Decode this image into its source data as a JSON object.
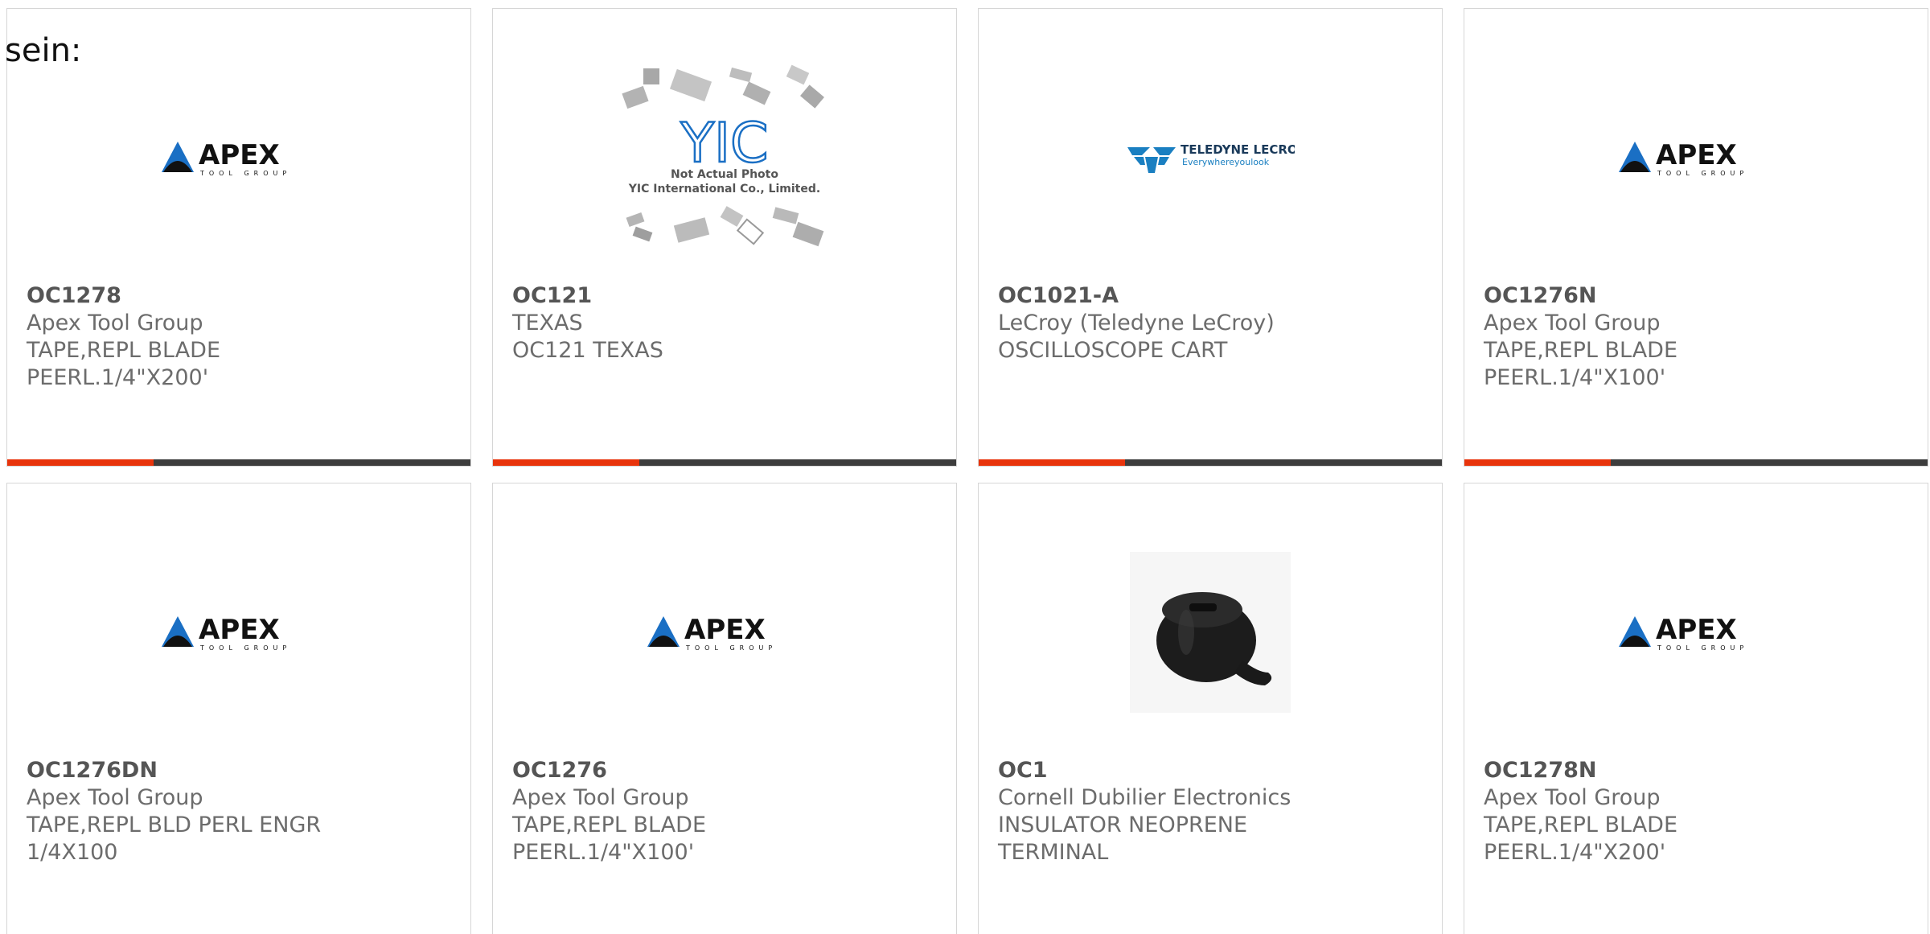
{
  "lead_text": "sein:",
  "colors": {
    "accent": "#e8340c",
    "bar": "#3d3d3d",
    "border": "#d6d6d6",
    "teledyne_blue": "#1a7fc1"
  },
  "cards": [
    {
      "pn": "OC1278",
      "mfr": "Apex Tool Group",
      "desc1": "TAPE,REPL BLADE",
      "desc2": "PEERL.1/4\"X200'",
      "image": "apex-logo",
      "logo_main": "APEX",
      "logo_sub": "TOOL GROUP"
    },
    {
      "pn": "OC121",
      "mfr": "TEXAS",
      "desc1": "OC121 TEXAS",
      "desc2": "",
      "image": "yic-placeholder",
      "logo_main": "YIC",
      "photo_note": "Not Actual Photo",
      "photo_company": "YIC International Co., Limited."
    },
    {
      "pn": "OC1021-A",
      "mfr": "LeCroy (Teledyne LeCroy)",
      "desc1": "OSCILLOSCOPE CART",
      "desc2": "",
      "image": "teledyne-logo",
      "logo_main": "TELEDYNE LECROY",
      "logo_sub": "Everywhereyoulook"
    },
    {
      "pn": "OC1276N",
      "mfr": "Apex Tool Group",
      "desc1": "TAPE,REPL BLADE",
      "desc2": "PEERL.1/4\"X100'",
      "image": "apex-logo",
      "logo_main": "APEX",
      "logo_sub": "TOOL GROUP"
    },
    {
      "pn": "OC1276DN",
      "mfr": "Apex Tool Group",
      "desc1": "TAPE,REPL BLD PERL ENGR",
      "desc2": "1/4X100",
      "image": "apex-logo",
      "logo_main": "APEX",
      "logo_sub": "TOOL GROUP"
    },
    {
      "pn": "OC1276",
      "mfr": "Apex Tool Group",
      "desc1": "TAPE,REPL BLADE",
      "desc2": "PEERL.1/4\"X100'",
      "image": "apex-logo",
      "logo_main": "APEX",
      "logo_sub": "TOOL GROUP"
    },
    {
      "pn": "OC1",
      "mfr": "Cornell Dubilier Electronics",
      "desc1": "INSULATOR NEOPRENE",
      "desc2": "TERMINAL",
      "image": "neoprene-insulator-photo"
    },
    {
      "pn": "OC1278N",
      "mfr": "Apex Tool Group",
      "desc1": "TAPE,REPL BLADE",
      "desc2": "PEERL.1/4\"X200'",
      "image": "apex-logo",
      "logo_main": "APEX",
      "logo_sub": "TOOL GROUP"
    }
  ]
}
